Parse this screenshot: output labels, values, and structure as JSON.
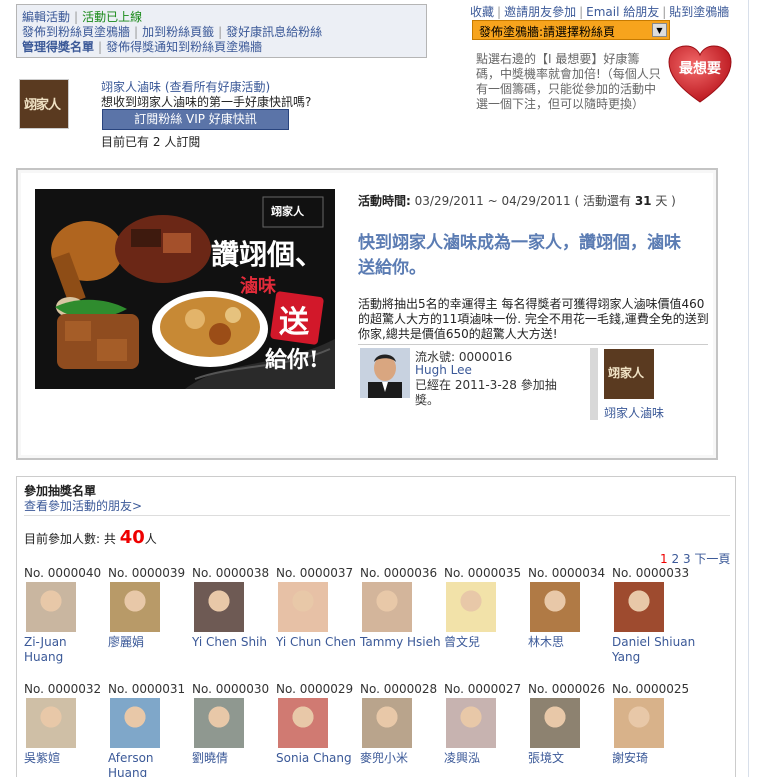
{
  "admin": {
    "edit_activity": "編輯活動",
    "status_live": "活動已上線",
    "post_wall": "發佈到粉絲頁塗鴉牆",
    "add_tab": "加到粉絲頁籤",
    "send_fans": "發好康訊息給粉絲",
    "manage_winners": "管理得獎名單",
    "post_winner_notice": "發佈得獎通知到粉絲頁塗鴉牆"
  },
  "top_links": [
    "收藏",
    "邀請朋友參加",
    "Email 給朋友",
    "貼到塗鴉牆"
  ],
  "post_select": {
    "value": "發佈塗鴉牆:請選擇粉絲頁"
  },
  "right_desc": "點選右邊的【I 最想要】好康籌碼，中獎機率就會加倍!（每個人只有一個籌碼，只能從參加的活動中選一個下注，但可以隨時更換）",
  "heart_label": "最想要",
  "store": {
    "logo_text": "翊家人",
    "name": "翊家人滷味",
    "see_all": "(查看所有好康活動)",
    "question": "想收到翊家人滷味的第一手好康快訊嗎?",
    "vip_button": "訂閱粉絲 VIP 好康快訊",
    "sub_prefix": "目前已有",
    "sub_count": "2",
    "sub_suffix": "人訂閱"
  },
  "activity": {
    "banner_text": [
      "讚翊個、",
      "滷味",
      "送",
      "給你!"
    ],
    "banner_brand": "翊家人",
    "time_label": "活動時間:",
    "time_range": "03/29/2011 ~ 04/29/2011",
    "remain_prefix": "( 活動還有",
    "remain_days": "31",
    "remain_suffix": "天 )",
    "title": "快到翊家人滷味成為一家人，讚翊個，滷味送給你。",
    "desc": "活動將抽出5名的幸運得主 每名得獎者可獲得翊家人滷味價值460的超驚人大方的11項滷味一份. 完全不用花一毛錢,運費全免的送到你家,總共是價值650的超驚人大方送!",
    "latest": {
      "serial": "流水號: 0000016",
      "name": "Hugh Lee",
      "joined": "已經在 2011-3-28 參加抽獎。"
    },
    "shop_name": "翊家人滷味"
  },
  "participants": {
    "title": "參加抽獎名單",
    "see_friends": "查看參加活動的朋友>",
    "count_prefix": "目前參加人數: 共",
    "count": "40",
    "count_suffix": "人",
    "pager": {
      "current": "1",
      "pages": [
        "2",
        "3"
      ],
      "next": "下一頁"
    },
    "people": [
      {
        "no": "No. 0000040",
        "name": "Zi-Juan Huang",
        "color": "#c9b6a0"
      },
      {
        "no": "No. 0000039",
        "name": "廖麗娟",
        "color": "#b89a68"
      },
      {
        "no": "No. 0000038",
        "name": "Yi Chen Shih",
        "color": "#6e5a54"
      },
      {
        "no": "No. 0000037",
        "name": "Yi Chun Chen",
        "color": "#e7c1a6"
      },
      {
        "no": "No. 0000036",
        "name": "Tammy Hsieh",
        "color": "#d3b59b"
      },
      {
        "no": "No. 0000035",
        "name": "曾文兒",
        "color": "#f2e2a9"
      },
      {
        "no": "No. 0000034",
        "name": "林木思",
        "color": "#b07a45"
      },
      {
        "no": "No. 0000033",
        "name": "Daniel Shiuan Yang",
        "color": "#9e4b2f"
      },
      {
        "no": "No. 0000032",
        "name": "吳紫媗",
        "color": "#cfbfa6"
      },
      {
        "no": "No. 0000031",
        "name": "Aferson Huang",
        "color": "#7fa7c9"
      },
      {
        "no": "No. 0000030",
        "name": "劉曉倩",
        "color": "#8f9890"
      },
      {
        "no": "No. 0000029",
        "name": "Sonia Chang",
        "color": "#d07a72"
      },
      {
        "no": "No. 0000028",
        "name": "麥兜小米",
        "color": "#b9a48c"
      },
      {
        "no": "No. 0000027",
        "name": "凌興泓",
        "color": "#c7b3b0"
      },
      {
        "no": "No. 0000026",
        "name": "張境文",
        "color": "#8d8270"
      },
      {
        "no": "No. 0000025",
        "name": "謝安琦",
        "color": "#d8b28a"
      }
    ]
  }
}
